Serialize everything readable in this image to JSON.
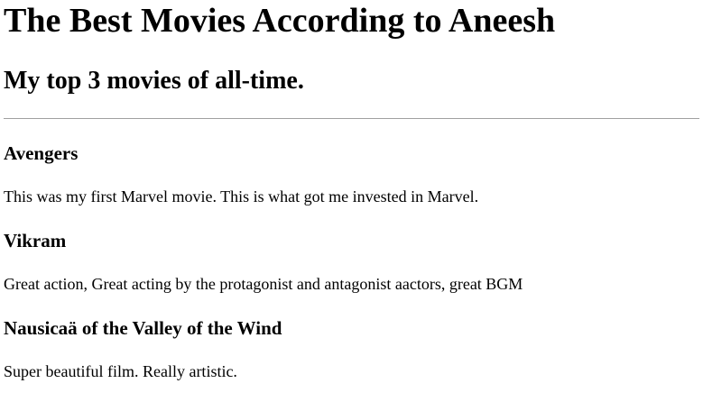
{
  "page": {
    "title": "The Best Movies According to Aneesh",
    "subtitle": "My top 3 movies of all-time."
  },
  "movies": [
    {
      "title": "Avengers",
      "description": "This was my first Marvel movie. This is what got me invested in Marvel."
    },
    {
      "title": "Vikram",
      "description": "Great action, Great acting by the protagonist and antagonist aactors, great BGM"
    },
    {
      "title": "Nausicaä of the Valley of the Wind",
      "description": "Super beautiful film. Really artistic."
    }
  ]
}
